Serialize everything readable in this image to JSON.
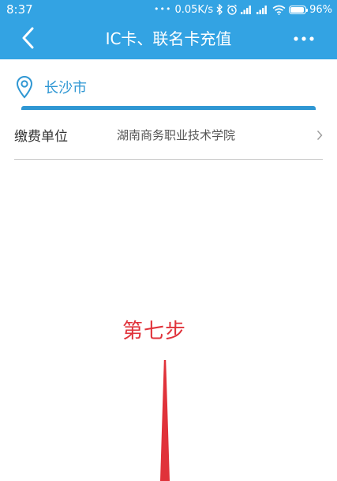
{
  "status_bar": {
    "time": "8:37",
    "network_speed": "0.05K/s",
    "battery_percent": "96%",
    "battery_level": 0.96,
    "icons": [
      "bluetooth-icon",
      "alarm-icon",
      "signal-icon",
      "signal-icon",
      "wifi-icon",
      "battery-icon"
    ]
  },
  "header": {
    "title": "IC卡、联名卡充值",
    "back_icon": "chevron-left-icon",
    "more_icon": "more-icon"
  },
  "location": {
    "icon": "location-pin-icon",
    "city": "长沙市"
  },
  "payee": {
    "label": "缴费单位",
    "value": "湖南商务职业技术学院",
    "chevron_icon": "chevron-right-icon"
  },
  "annotation": {
    "step_text": "第七步"
  },
  "colors": {
    "header_bg": "#33a3e3",
    "accent_blue": "#2f97d3",
    "annotation_red": "#e0323a"
  }
}
